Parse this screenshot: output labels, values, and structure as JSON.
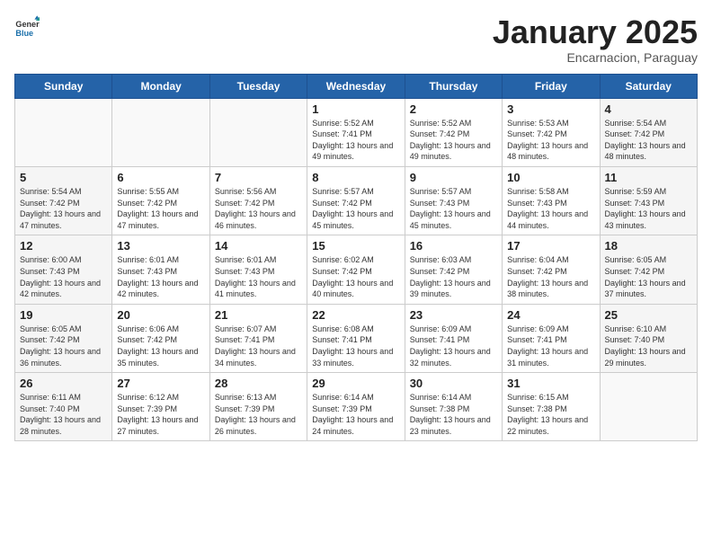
{
  "header": {
    "logo_general": "General",
    "logo_blue": "Blue",
    "month_title": "January 2025",
    "subtitle": "Encarnacion, Paraguay"
  },
  "weekdays": [
    "Sunday",
    "Monday",
    "Tuesday",
    "Wednesday",
    "Thursday",
    "Friday",
    "Saturday"
  ],
  "weeks": [
    [
      {
        "day": "",
        "content": ""
      },
      {
        "day": "",
        "content": ""
      },
      {
        "day": "",
        "content": ""
      },
      {
        "day": "1",
        "content": "Sunrise: 5:52 AM\nSunset: 7:41 PM\nDaylight: 13 hours\nand 49 minutes."
      },
      {
        "day": "2",
        "content": "Sunrise: 5:52 AM\nSunset: 7:42 PM\nDaylight: 13 hours\nand 49 minutes."
      },
      {
        "day": "3",
        "content": "Sunrise: 5:53 AM\nSunset: 7:42 PM\nDaylight: 13 hours\nand 48 minutes."
      },
      {
        "day": "4",
        "content": "Sunrise: 5:54 AM\nSunset: 7:42 PM\nDaylight: 13 hours\nand 48 minutes."
      }
    ],
    [
      {
        "day": "5",
        "content": "Sunrise: 5:54 AM\nSunset: 7:42 PM\nDaylight: 13 hours\nand 47 minutes."
      },
      {
        "day": "6",
        "content": "Sunrise: 5:55 AM\nSunset: 7:42 PM\nDaylight: 13 hours\nand 47 minutes."
      },
      {
        "day": "7",
        "content": "Sunrise: 5:56 AM\nSunset: 7:42 PM\nDaylight: 13 hours\nand 46 minutes."
      },
      {
        "day": "8",
        "content": "Sunrise: 5:57 AM\nSunset: 7:42 PM\nDaylight: 13 hours\nand 45 minutes."
      },
      {
        "day": "9",
        "content": "Sunrise: 5:57 AM\nSunset: 7:43 PM\nDaylight: 13 hours\nand 45 minutes."
      },
      {
        "day": "10",
        "content": "Sunrise: 5:58 AM\nSunset: 7:43 PM\nDaylight: 13 hours\nand 44 minutes."
      },
      {
        "day": "11",
        "content": "Sunrise: 5:59 AM\nSunset: 7:43 PM\nDaylight: 13 hours\nand 43 minutes."
      }
    ],
    [
      {
        "day": "12",
        "content": "Sunrise: 6:00 AM\nSunset: 7:43 PM\nDaylight: 13 hours\nand 42 minutes."
      },
      {
        "day": "13",
        "content": "Sunrise: 6:01 AM\nSunset: 7:43 PM\nDaylight: 13 hours\nand 42 minutes."
      },
      {
        "day": "14",
        "content": "Sunrise: 6:01 AM\nSunset: 7:43 PM\nDaylight: 13 hours\nand 41 minutes."
      },
      {
        "day": "15",
        "content": "Sunrise: 6:02 AM\nSunset: 7:42 PM\nDaylight: 13 hours\nand 40 minutes."
      },
      {
        "day": "16",
        "content": "Sunrise: 6:03 AM\nSunset: 7:42 PM\nDaylight: 13 hours\nand 39 minutes."
      },
      {
        "day": "17",
        "content": "Sunrise: 6:04 AM\nSunset: 7:42 PM\nDaylight: 13 hours\nand 38 minutes."
      },
      {
        "day": "18",
        "content": "Sunrise: 6:05 AM\nSunset: 7:42 PM\nDaylight: 13 hours\nand 37 minutes."
      }
    ],
    [
      {
        "day": "19",
        "content": "Sunrise: 6:05 AM\nSunset: 7:42 PM\nDaylight: 13 hours\nand 36 minutes."
      },
      {
        "day": "20",
        "content": "Sunrise: 6:06 AM\nSunset: 7:42 PM\nDaylight: 13 hours\nand 35 minutes."
      },
      {
        "day": "21",
        "content": "Sunrise: 6:07 AM\nSunset: 7:41 PM\nDaylight: 13 hours\nand 34 minutes."
      },
      {
        "day": "22",
        "content": "Sunrise: 6:08 AM\nSunset: 7:41 PM\nDaylight: 13 hours\nand 33 minutes."
      },
      {
        "day": "23",
        "content": "Sunrise: 6:09 AM\nSunset: 7:41 PM\nDaylight: 13 hours\nand 32 minutes."
      },
      {
        "day": "24",
        "content": "Sunrise: 6:09 AM\nSunset: 7:41 PM\nDaylight: 13 hours\nand 31 minutes."
      },
      {
        "day": "25",
        "content": "Sunrise: 6:10 AM\nSunset: 7:40 PM\nDaylight: 13 hours\nand 29 minutes."
      }
    ],
    [
      {
        "day": "26",
        "content": "Sunrise: 6:11 AM\nSunset: 7:40 PM\nDaylight: 13 hours\nand 28 minutes."
      },
      {
        "day": "27",
        "content": "Sunrise: 6:12 AM\nSunset: 7:39 PM\nDaylight: 13 hours\nand 27 minutes."
      },
      {
        "day": "28",
        "content": "Sunrise: 6:13 AM\nSunset: 7:39 PM\nDaylight: 13 hours\nand 26 minutes."
      },
      {
        "day": "29",
        "content": "Sunrise: 6:14 AM\nSunset: 7:39 PM\nDaylight: 13 hours\nand 24 minutes."
      },
      {
        "day": "30",
        "content": "Sunrise: 6:14 AM\nSunset: 7:38 PM\nDaylight: 13 hours\nand 23 minutes."
      },
      {
        "day": "31",
        "content": "Sunrise: 6:15 AM\nSunset: 7:38 PM\nDaylight: 13 hours\nand 22 minutes."
      },
      {
        "day": "",
        "content": ""
      }
    ]
  ]
}
